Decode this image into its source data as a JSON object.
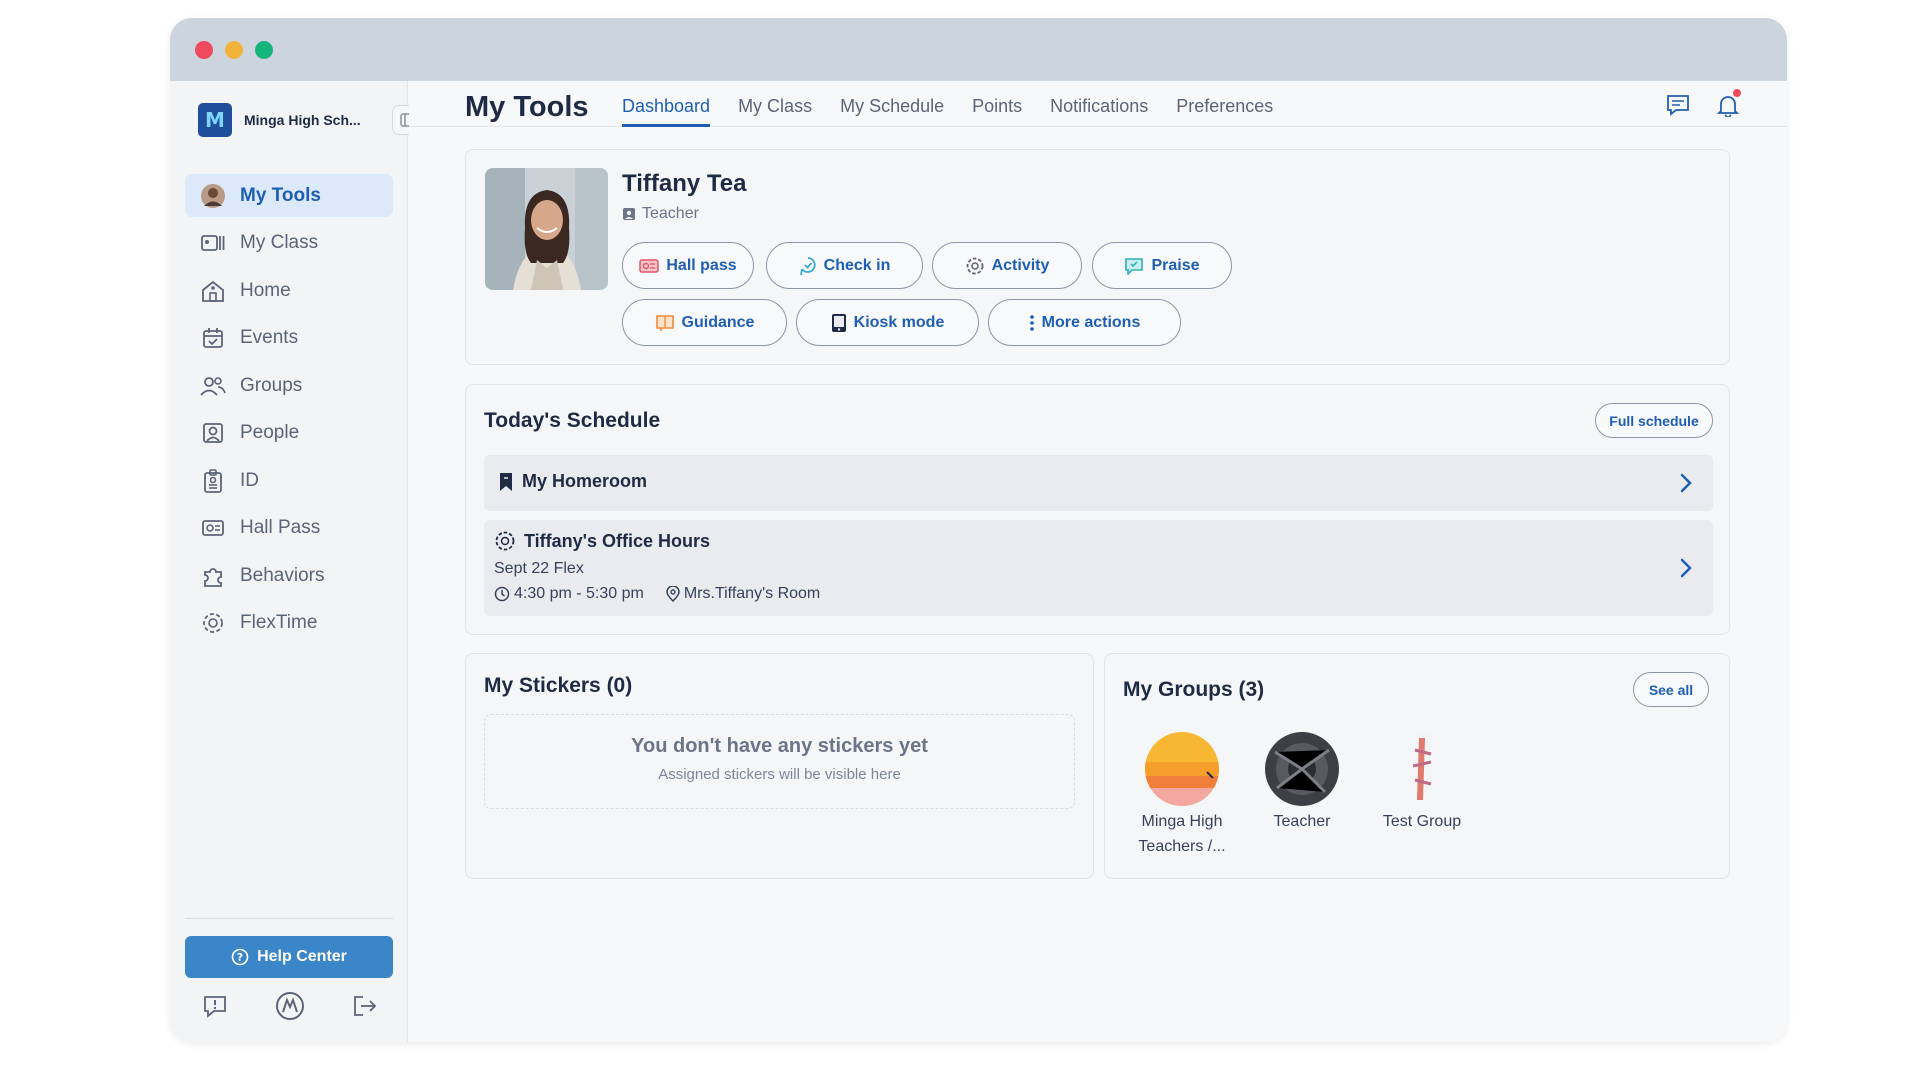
{
  "sidebar": {
    "school_name": "Minga High Sch...",
    "items": [
      {
        "label": "My Tools",
        "icon": "avatar-icon",
        "active": true
      },
      {
        "label": "My Class",
        "icon": "id-cards-icon"
      },
      {
        "label": "Home",
        "icon": "home-icon"
      },
      {
        "label": "Events",
        "icon": "calendar-icon"
      },
      {
        "label": "Groups",
        "icon": "users-icon"
      },
      {
        "label": "People",
        "icon": "person-icon"
      },
      {
        "label": "ID",
        "icon": "id-badge-icon"
      },
      {
        "label": "Hall Pass",
        "icon": "pass-icon"
      },
      {
        "label": "Behaviors",
        "icon": "puzzle-icon"
      },
      {
        "label": "FlexTime",
        "icon": "flex-gear-icon"
      }
    ],
    "help_center": "Help Center"
  },
  "header": {
    "title": "My Tools",
    "tabs": [
      "Dashboard",
      "My Class",
      "My Schedule",
      "Points",
      "Notifications",
      "Preferences"
    ],
    "active_tab": "Dashboard"
  },
  "profile": {
    "name": "Tiffany Tea",
    "role": "Teacher",
    "actions": [
      "Hall pass",
      "Check in",
      "Activity",
      "Praise",
      "Guidance",
      "Kiosk mode",
      "More actions"
    ]
  },
  "schedule": {
    "title": "Today's Schedule",
    "full_schedule": "Full schedule",
    "items": [
      {
        "title": "My Homeroom"
      },
      {
        "title": "Tiffany's Office Hours",
        "subtitle": "Sept 22 Flex",
        "time": "4:30 pm - 5:30 pm",
        "location": "Mrs.Tiffany's Room"
      }
    ]
  },
  "stickers": {
    "title": "My Stickers (0)",
    "empty_title": "You don't have any stickers yet",
    "empty_sub": "Assigned stickers will be visible here"
  },
  "groups": {
    "title": "My Groups (3)",
    "see_all": "See all",
    "items": [
      {
        "name_line1": "Minga High",
        "name_line2": "Teachers /..."
      },
      {
        "name_line1": "Teacher"
      },
      {
        "name_line1": "Test Group"
      }
    ]
  },
  "colors": {
    "accent": "#1f5fb3",
    "help_button": "#3a86c8",
    "notification_dot": "#ee4b5f"
  }
}
